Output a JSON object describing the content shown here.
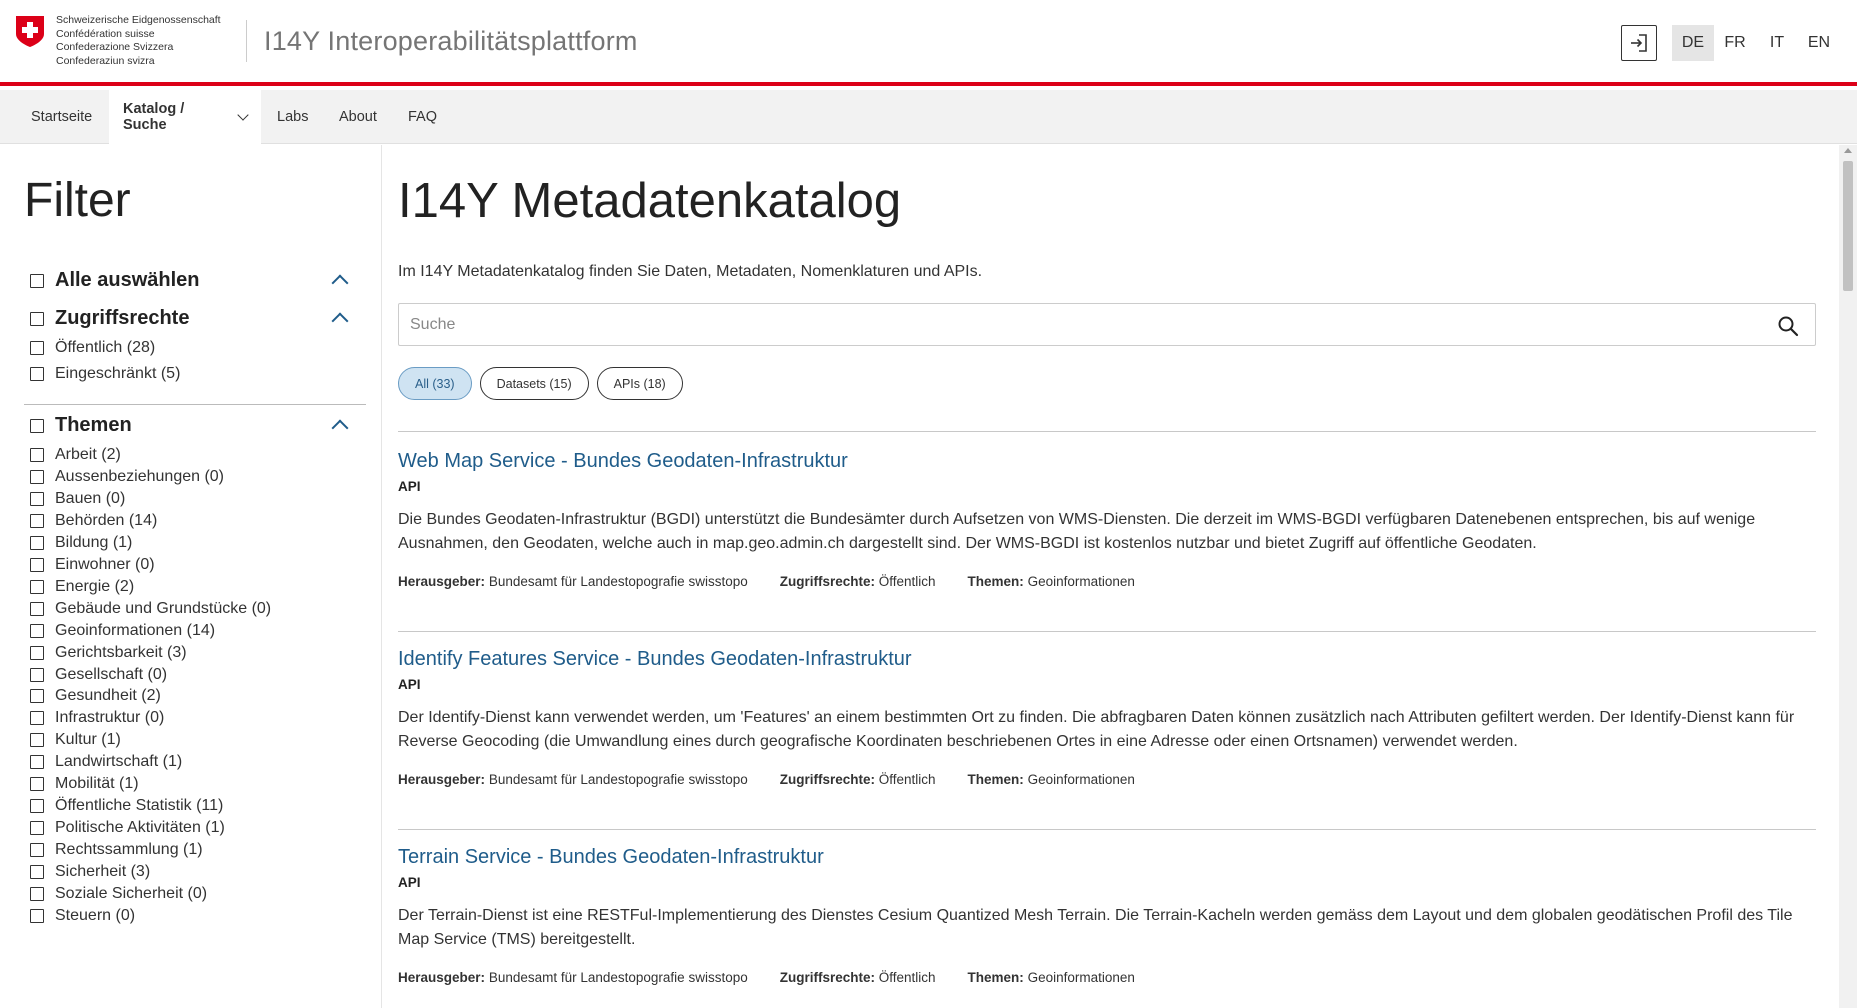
{
  "header": {
    "federation_names": [
      "Schweizerische Eidgenossenschaft",
      "Confédération suisse",
      "Confederazione Svizzera",
      "Confederaziun svizra"
    ],
    "site_title": "I14Y Interoperabilitätsplattform",
    "languages": [
      "DE",
      "FR",
      "IT",
      "EN"
    ],
    "active_language": "DE"
  },
  "nav": {
    "items": [
      "Startseite",
      "Katalog / Suche",
      "Labs",
      "About",
      "FAQ"
    ],
    "active": "Katalog / Suche"
  },
  "sidebar": {
    "title": "Filter",
    "select_all": "Alle auswählen",
    "access": {
      "title": "Zugriffsrechte",
      "options": [
        "Öffentlich (28)",
        "Eingeschränkt (5)"
      ]
    },
    "themes": {
      "title": "Themen",
      "options": [
        "Arbeit (2)",
        "Aussenbeziehungen (0)",
        "Bauen (0)",
        "Behörden (14)",
        "Bildung (1)",
        "Einwohner (0)",
        "Energie (2)",
        "Gebäude und Grundstücke (0)",
        "Geoinformationen (14)",
        "Gerichtsbarkeit (3)",
        "Gesellschaft (0)",
        "Gesundheit (2)",
        "Infrastruktur (0)",
        "Kultur (1)",
        "Landwirtschaft (1)",
        "Mobilität (1)",
        "Öffentliche Statistik (11)",
        "Politische Aktivitäten (1)",
        "Rechtssammlung (1)",
        "Sicherheit (3)",
        "Soziale Sicherheit (0)",
        "Steuern (0)"
      ]
    }
  },
  "main": {
    "title": "I14Y Metadatenkatalog",
    "intro": "Im I14Y Metadatenkatalog finden Sie Daten, Metadaten, Nomenklaturen und APIs.",
    "search_placeholder": "Suche",
    "chips": [
      "All (33)",
      "Datasets (15)",
      "APIs (18)"
    ],
    "active_chip": "All (33)",
    "meta_labels": {
      "publisher": "Herausgeber:",
      "access": "Zugriffsrechte:",
      "themes": "Themen:"
    },
    "results": [
      {
        "title": "Web Map Service - Bundes Geodaten-Infrastruktur",
        "type": "API",
        "description": "Die Bundes Geodaten-Infrastruktur (BGDI) unterstützt die Bundesämter durch Aufsetzen von WMS-Diensten. Die derzeit im WMS-BGDI verfügbaren Datenebenen entsprechen, bis auf wenige Ausnahmen, den Geodaten, welche auch in map.geo.admin.ch dargestellt sind. Der WMS-BGDI ist kostenlos nutzbar und bietet Zugriff auf öffentliche Geodaten.",
        "publisher": "Bundesamt für Landestopografie swisstopo",
        "access": "Öffentlich",
        "themes": "Geoinformationen"
      },
      {
        "title": "Identify Features Service - Bundes Geodaten-Infrastruktur",
        "type": "API",
        "description": "Der Identify-Dienst kann verwendet werden, um 'Features' an einem bestimmten Ort zu finden. Die abfragbaren Daten können zusätzlich nach Attributen gefiltert werden. Der Identify-Dienst kann für Reverse Geocoding (die Umwandlung eines durch geografische Koordinaten beschriebenen Ortes in eine Adresse oder einen Ortsnamen) verwendet werden.",
        "publisher": "Bundesamt für Landestopografie swisstopo",
        "access": "Öffentlich",
        "themes": "Geoinformationen"
      },
      {
        "title": "Terrain Service - Bundes Geodaten-Infrastruktur",
        "type": "API",
        "description": "Der Terrain-Dienst ist eine RESTFul-Implementierung des Dienstes Cesium Quantized Mesh Terrain. Die Terrain-Kacheln werden gemäss dem Layout und dem globalen geodätischen Profil des Tile Map Service (TMS) bereitgestellt.",
        "publisher": "Bundesamt für Landestopografie swisstopo",
        "access": "Öffentlich",
        "themes": "Geoinformationen"
      }
    ]
  },
  "colors": {
    "accent_red": "#dc0018",
    "link_blue": "#1f5c8a",
    "chip_active_bg": "#cfe3f2"
  }
}
